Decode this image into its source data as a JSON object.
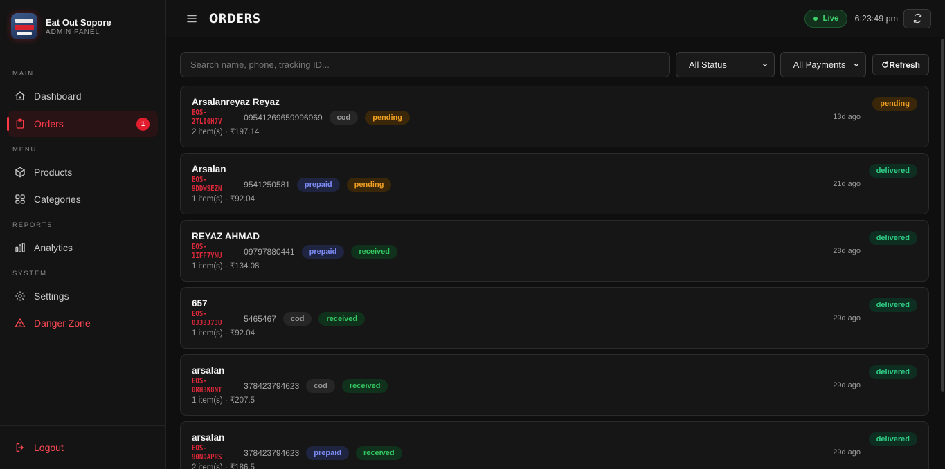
{
  "brand": {
    "name": "Eat Out Sopore",
    "subtitle": "ADMIN PANEL"
  },
  "sidebar": {
    "sections": [
      {
        "label": "MAIN",
        "items": [
          {
            "label": "Dashboard",
            "icon": "home-icon"
          },
          {
            "label": "Orders",
            "icon": "clipboard-icon",
            "badge": "1",
            "active": true
          }
        ]
      },
      {
        "label": "MENU",
        "items": [
          {
            "label": "Products",
            "icon": "box-icon"
          },
          {
            "label": "Categories",
            "icon": "grid-icon"
          }
        ]
      },
      {
        "label": "REPORTS",
        "items": [
          {
            "label": "Analytics",
            "icon": "bar-chart-icon"
          }
        ]
      },
      {
        "label": "SYSTEM",
        "items": [
          {
            "label": "Settings",
            "icon": "gear-icon"
          },
          {
            "label": "Danger Zone",
            "icon": "warning-icon"
          }
        ]
      }
    ],
    "logout_label": "Logout"
  },
  "header": {
    "title": "ORDERS",
    "live_label": "Live",
    "time": "6:23:49 pm"
  },
  "filters": {
    "search_placeholder": "Search name, phone, tracking ID...",
    "status_selected": "All Status",
    "payment_selected": "All Payments",
    "refresh_label": "Refresh"
  },
  "orders": [
    {
      "customer": "Arsalanreyaz Reyaz",
      "tracking": "EOS-2TLI0H7V",
      "phone": "09541269659996969",
      "payment": "cod",
      "payment_status": "pending",
      "summary": "2 item(s) · ₹197.14",
      "ago": "13d ago",
      "status": "pending"
    },
    {
      "customer": "Arsalan",
      "tracking": "EOS-9DDWSEZN",
      "phone": "9541250581",
      "payment": "prepaid",
      "payment_status": "pending",
      "summary": "1 item(s) · ₹92.04",
      "ago": "21d ago",
      "status": "delivered"
    },
    {
      "customer": "REYAZ AHMAD",
      "tracking": "EOS-1IFF7YNU",
      "phone": "09797880441",
      "payment": "prepaid",
      "payment_status": "received",
      "summary": "1 item(s) · ₹134.08",
      "ago": "28d ago",
      "status": "delivered"
    },
    {
      "customer": "657",
      "tracking": "EOS-0J33J7JU",
      "phone": "5465467",
      "payment": "cod",
      "payment_status": "received",
      "summary": "1 item(s) · ₹92.04",
      "ago": "29d ago",
      "status": "delivered"
    },
    {
      "customer": "arsalan",
      "tracking": "EOS-0RH3K8NT",
      "phone": "378423794623",
      "payment": "cod",
      "payment_status": "received",
      "summary": "1 item(s) · ₹207.5",
      "ago": "29d ago",
      "status": "delivered"
    },
    {
      "customer": "arsalan",
      "tracking": "EOS-90NDAPRS",
      "phone": "378423794623",
      "payment": "prepaid",
      "payment_status": "received",
      "summary": "2 item(s) · ₹186.5",
      "ago": "29d ago",
      "status": "delivered"
    }
  ],
  "colors": {
    "accent": "#ff3b4a",
    "background": "#0f0f0f",
    "live": "#3fd16d"
  }
}
